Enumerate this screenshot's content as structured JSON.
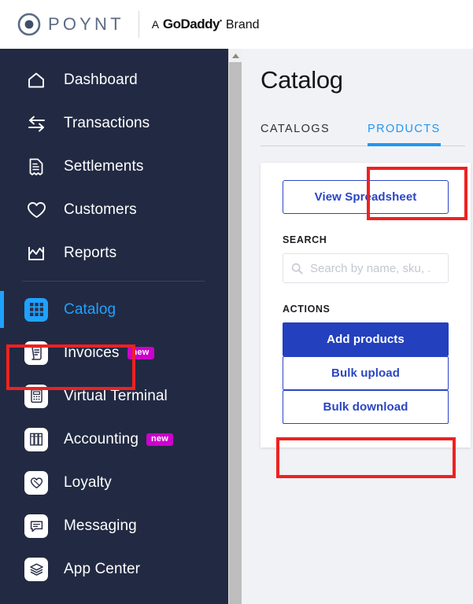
{
  "brand": {
    "logo_icon": "poynt-circle-mark",
    "logo_text": "POYNT",
    "tagline_prefix": "A",
    "tagline_brand": "GoDaddy",
    "tagline_suffix": "Brand"
  },
  "sidebar": {
    "items": [
      {
        "label": "Dashboard",
        "icon": "home-icon",
        "active": false,
        "badge": ""
      },
      {
        "label": "Transactions",
        "icon": "transfer-arrows-icon",
        "active": false,
        "badge": ""
      },
      {
        "label": "Settlements",
        "icon": "receipt-icon",
        "active": false,
        "badge": ""
      },
      {
        "label": "Customers",
        "icon": "heart-icon",
        "active": false,
        "badge": ""
      },
      {
        "label": "Reports",
        "icon": "chart-line-icon",
        "active": false,
        "badge": ""
      },
      {
        "label": "Catalog",
        "icon": "grid-icon",
        "active": true,
        "badge": ""
      },
      {
        "label": "Invoices",
        "icon": "invoice-scroll-icon",
        "active": false,
        "badge": "new"
      },
      {
        "label": "Virtual Terminal",
        "icon": "calculator-icon",
        "active": false,
        "badge": ""
      },
      {
        "label": "Accounting",
        "icon": "ledger-books-icon",
        "active": false,
        "badge": "new"
      },
      {
        "label": "Loyalty",
        "icon": "heart-hand-icon",
        "active": false,
        "badge": ""
      },
      {
        "label": "Messaging",
        "icon": "chat-bubble-icon",
        "active": false,
        "badge": ""
      },
      {
        "label": "App Center",
        "icon": "layers-icon",
        "active": false,
        "badge": ""
      }
    ]
  },
  "main": {
    "page_title": "Catalog",
    "tabs": [
      {
        "label": "CATALOGS",
        "active": false
      },
      {
        "label": "PRODUCTS",
        "active": true
      }
    ],
    "card": {
      "view_spreadsheet_label": "View Spreadsheet",
      "search_label": "SEARCH",
      "search_placeholder": "Search by name, sku, .",
      "search_value": "",
      "search_icon": "magnifier-icon",
      "actions_label": "ACTIONS",
      "actions": [
        {
          "label": "Add products",
          "style": "primary"
        },
        {
          "label": "Bulk upload",
          "style": "outline"
        },
        {
          "label": "Bulk download",
          "style": "outline"
        }
      ]
    }
  },
  "scrollbar": {
    "up_arrow_icon": "triangle-up-icon"
  },
  "annotations": [
    {
      "target": "Catalog sidebar item"
    },
    {
      "target": "PRODUCTS tab"
    },
    {
      "target": "Bulk upload button"
    }
  ],
  "colors": {
    "sidebar_bg": "#222a43",
    "accent_blue": "#1fa2ff",
    "tab_blue": "#2196f3",
    "primary_button": "#2340be",
    "outline_button": "#2b45c4",
    "badge_new": "#cc00cc",
    "annotation_red": "#ef2121",
    "page_bg": "#f1f2f6"
  }
}
